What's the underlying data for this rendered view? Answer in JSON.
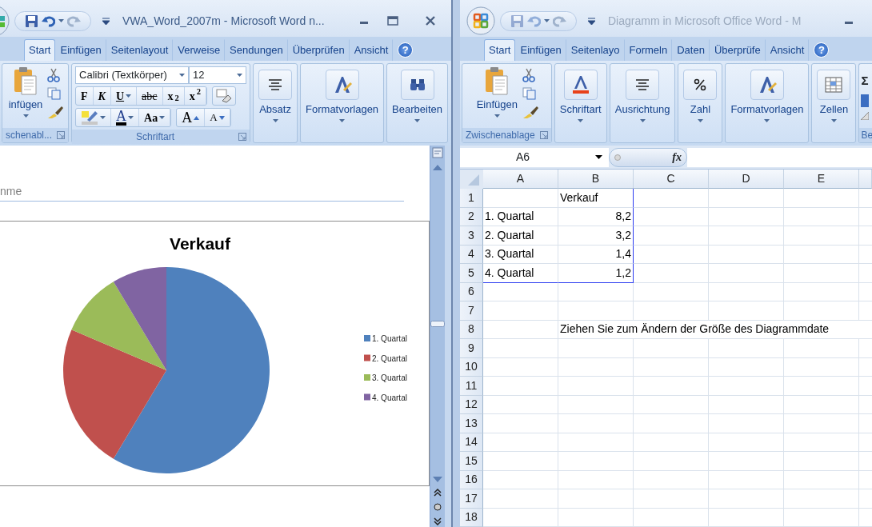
{
  "word_window": {
    "title": "VWA_Word_2007m - Microsoft Word n...",
    "active": true,
    "tabs": [
      {
        "label": "Start",
        "selected": true
      },
      {
        "label": "Einfügen",
        "selected": false
      },
      {
        "label": "Seitenlayout",
        "selected": false
      },
      {
        "label": "Verweise",
        "selected": false
      },
      {
        "label": "Sendungen",
        "selected": false
      },
      {
        "label": "Überprüfen",
        "selected": false
      },
      {
        "label": "Ansicht",
        "selected": false
      }
    ],
    "help": "?",
    "ribbon_groups": [
      {
        "kind": "clipboard",
        "caption": "schenabl...",
        "button": "infügen"
      },
      {
        "kind": "font",
        "caption": "Schriftart",
        "font_name": "Calibri (Textkörper)",
        "font_size": "12",
        "format_buttons": [
          {
            "kind": "bold",
            "text": "F"
          },
          {
            "kind": "italic",
            "text": "K"
          },
          {
            "kind": "underline",
            "text": "U"
          },
          {
            "kind": "strike",
            "text": "abc"
          },
          {
            "kind": "plain",
            "text": "x$_{2}$"
          },
          {
            "kind": "plain",
            "text": "x$^{2}$"
          }
        ],
        "style_buttons": [
          {
            "kind": "highlight"
          },
          {
            "kind": "font-color",
            "text": "A"
          },
          {
            "kind": "case",
            "text": "Aa"
          },
          {
            "kind": "grow",
            "text": "A"
          },
          {
            "kind": "shrink",
            "text": "A"
          }
        ]
      },
      {
        "kind": "align",
        "label": "Absatz"
      },
      {
        "kind": "styles",
        "label": "Formatvorlagen"
      },
      {
        "kind": "find",
        "label": "Bearbeiten"
      }
    ],
    "document": {
      "heading_fragment": "nme",
      "chart": {
        "chart_data": {
          "type": "pie",
          "title": "Verkauf",
          "categories": [
            "1. Quartal",
            "2. Quartal",
            "3. Quartal",
            "4. Quartal"
          ],
          "values": [
            58.57,
            22.86,
            10,
            8.57
          ],
          "legend": "right"
        }
      }
    }
  },
  "excel_window": {
    "title": "Diagramm in Microsoft Office Word - M",
    "active": false,
    "tabs": [
      {
        "label": "Start",
        "selected": true
      },
      {
        "label": "Einfügen",
        "selected": false
      },
      {
        "label": "Seitenlayo",
        "selected": false
      },
      {
        "label": "Formeln",
        "selected": false
      },
      {
        "label": "Daten",
        "selected": false
      },
      {
        "label": "Überprüfe",
        "selected": false
      },
      {
        "label": "Ansicht",
        "selected": false
      }
    ],
    "help": "?",
    "ribbon_groups": [
      {
        "kind": "clipboard",
        "caption": "Zwischenablage",
        "button": "Einfügen"
      },
      {
        "kind": "font-color",
        "label": "Schriftart"
      },
      {
        "kind": "align",
        "label": "Ausrichtung"
      },
      {
        "kind": "percent",
        "label": "Zahl"
      },
      {
        "kind": "styles",
        "label": "Formatvorlagen"
      },
      {
        "kind": "cells",
        "label": "Zellen"
      },
      {
        "kind": "partial",
        "caption": "Be",
        "symbol": "Σ"
      }
    ],
    "name_box": "A6",
    "function_label": "fx",
    "columns": [
      "A",
      "B",
      "C",
      "D",
      "E"
    ],
    "rows": [
      {
        "number": "1",
        "in_range": true,
        "cells": [
          null,
          {
            "kind": "text",
            "text": "Verkauf"
          },
          null,
          null,
          null
        ]
      },
      {
        "number": "2",
        "in_range": true,
        "cells": [
          {
            "kind": "text",
            "text": "1. Quartal"
          },
          {
            "kind": "number",
            "text": "8,2"
          },
          null,
          null,
          null
        ]
      },
      {
        "number": "3",
        "in_range": true,
        "cells": [
          {
            "kind": "text",
            "text": "2. Quartal"
          },
          {
            "kind": "number",
            "text": "3,2"
          },
          null,
          null,
          null
        ]
      },
      {
        "number": "4",
        "in_range": true,
        "cells": [
          {
            "kind": "text",
            "text": "3. Quartal"
          },
          {
            "kind": "number",
            "text": "1,4"
          },
          null,
          null,
          null
        ]
      },
      {
        "number": "5",
        "in_range": true,
        "cells": [
          {
            "kind": "text",
            "text": "4. Quartal"
          },
          {
            "kind": "number",
            "text": "1,2"
          },
          null,
          null,
          null
        ]
      },
      {
        "number": "6",
        "in_range": false,
        "cells": [
          null,
          null,
          null,
          null,
          null
        ]
      },
      {
        "number": "7",
        "in_range": false,
        "cells": [
          null,
          null,
          null,
          null,
          null
        ]
      },
      {
        "number": "8",
        "in_range": false,
        "cells": [
          null,
          {
            "kind": "overflow",
            "text": "Ziehen Sie zum Ändern der Größe des Diagrammdate"
          }
        ]
      },
      {
        "number": "9",
        "in_range": false,
        "cells": [
          null,
          null,
          null,
          null,
          null
        ]
      },
      {
        "number": "10",
        "in_range": false,
        "cells": [
          null,
          null,
          null,
          null,
          null
        ]
      },
      {
        "number": "11",
        "in_range": false,
        "cells": [
          null,
          null,
          null,
          null,
          null
        ]
      },
      {
        "number": "12",
        "in_range": false,
        "cells": [
          null,
          null,
          null,
          null,
          null
        ]
      },
      {
        "number": "13",
        "in_range": false,
        "cells": [
          null,
          null,
          null,
          null,
          null
        ]
      },
      {
        "number": "14",
        "in_range": false,
        "cells": [
          null,
          null,
          null,
          null,
          null
        ]
      },
      {
        "number": "15",
        "in_range": false,
        "cells": [
          null,
          null,
          null,
          null,
          null
        ]
      },
      {
        "number": "16",
        "in_range": false,
        "cells": [
          null,
          null,
          null,
          null,
          null
        ]
      },
      {
        "number": "17",
        "in_range": false,
        "cells": [
          null,
          null,
          null,
          null,
          null
        ]
      },
      {
        "number": "18",
        "in_range": false,
        "cells": [
          null,
          null,
          null,
          null,
          null
        ]
      }
    ]
  }
}
